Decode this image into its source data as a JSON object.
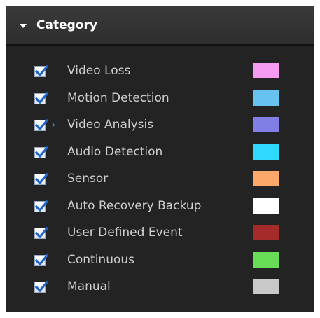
{
  "panel": {
    "title": "Category"
  },
  "categories": [
    {
      "label": "Video Loss",
      "checked": true,
      "color": "#f59bf2"
    },
    {
      "label": "Motion Detection",
      "checked": true,
      "color": "#66c2ee"
    },
    {
      "label": "Video Analysis",
      "checked": true,
      "color": "#7f7fe6",
      "hover": true
    },
    {
      "label": "Audio Detection",
      "checked": true,
      "color": "#2fd8ff"
    },
    {
      "label": "Sensor",
      "checked": true,
      "color": "#fca86b"
    },
    {
      "label": "Auto Recovery Backup",
      "checked": true,
      "color": "#ffffff"
    },
    {
      "label": "User Defined Event",
      "checked": true,
      "color": "#a52a2a"
    },
    {
      "label": "Continuous",
      "checked": true,
      "color": "#66dd55"
    },
    {
      "label": "Manual",
      "checked": true,
      "color": "#c8c8c8"
    }
  ]
}
